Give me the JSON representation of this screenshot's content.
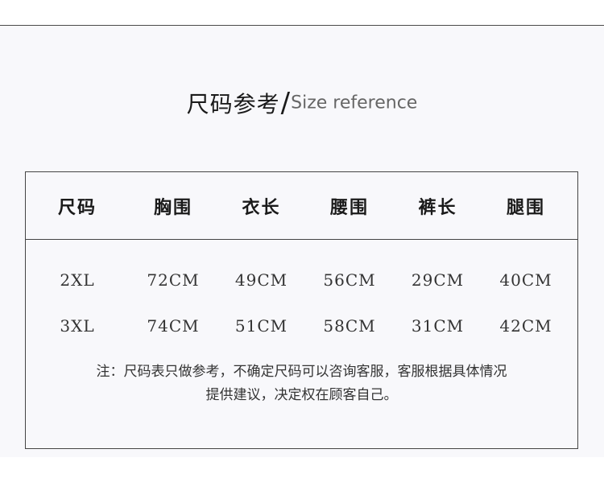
{
  "title": {
    "zh": "尺码参考",
    "slash": "/",
    "en": "Size reference"
  },
  "table": {
    "headers": [
      "尺码",
      "胸围",
      "衣长",
      "腰围",
      "裤长",
      "腿围"
    ],
    "rows": [
      [
        "2XL",
        "72CM",
        "49CM",
        "56CM",
        "29CM",
        "40CM"
      ],
      [
        "3XL",
        "74CM",
        "51CM",
        "58CM",
        "31CM",
        "42CM"
      ]
    ]
  },
  "note": {
    "line1": "注：尺码表只做参考，不确定尺码可以咨询客服，客服根据具体情况",
    "line2": "提供建议，决定权在顾客自己。"
  }
}
